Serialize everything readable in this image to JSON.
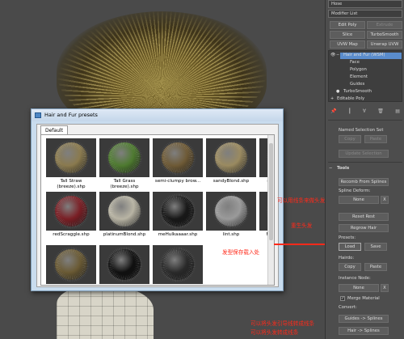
{
  "dialog": {
    "title": "Hair and Fur presets",
    "tab": "Default",
    "presets": [
      {
        "label": "Tall Straw\n(breeze).shp",
        "color": "#8a7a4e"
      },
      {
        "label": "Tall Grass\n(breeze).shp",
        "color": "#4e7a30"
      },
      {
        "label": "semi-clumpy brow...",
        "color": "#6e5a36"
      },
      {
        "label": "sandyBlond.shp",
        "color": "#9a8a60"
      },
      {
        "label": "redStraight.shp",
        "color": "#8a2028"
      },
      {
        "label": "redScraggle.shp",
        "color": "#7a1f25"
      },
      {
        "label": "platinumBlond.shp",
        "color": "#b8b4a4"
      },
      {
        "label": "meHulkaaaar.shp",
        "color": "#181818"
      },
      {
        "label": "lint.shp",
        "color": "#9a9a9a"
      },
      {
        "label": "FuzzyBrown.shp",
        "color": "#5e4424"
      },
      {
        "label": "",
        "color": "#6a5a34"
      },
      {
        "label": "",
        "color": "#101010"
      },
      {
        "label": "",
        "color": "#2a2a2a"
      }
    ]
  },
  "panel": {
    "top_field": "Hose",
    "modifier_list": "Modifier List",
    "buttons": {
      "edit_poly": "Edit Poly",
      "extrude": "Extrude",
      "slice": "Slice",
      "turbosmooth": "TurboSmooth",
      "uvw_map": "UVW Map",
      "unwrap_uvw": "Unwrap UVW"
    },
    "stack": {
      "hair_and_fur": "Hair and Fur (WSM)",
      "face": "Face",
      "polygon": "Polygon",
      "element": "Element",
      "guides": "Guides",
      "turbosmooth": "TurboSmooth",
      "editable_poly": "Editable Poly"
    },
    "named_selection_set": "Named Selection Set",
    "copy1": "Copy",
    "paste1": "Paste",
    "update_selection": "Update Selection",
    "tools_header": "Tools",
    "recomb_from_splines": "Recomb From Splines",
    "spline_deform": "Spline Deform:",
    "none1": "None",
    "x1": "X",
    "reset_rest": "Reset Rest",
    "regrow_hair": "Regrow Hair",
    "presets_label": "Presets:",
    "load": "Load",
    "save": "Save",
    "hairdo_label": "Hairdo:",
    "copy2": "Copy",
    "paste2": "Paste",
    "instance_node": "Instance Node:",
    "none2": "None",
    "x2": "X",
    "merge_material": "Merge Material",
    "convert_label": "Convert:",
    "guides_splines": "Guides -> Splines",
    "hair_splines": "Hair -> Splines"
  },
  "annotations": {
    "splines_note": "可以用线条来做头发",
    "regrow_note": "重生头发",
    "load_note": "发型保存载入处",
    "convert_note1": "可以将头发引导线转成线条",
    "convert_note2": "可以将头发转成线条"
  },
  "colors": {
    "annotation": "#ff2a1a",
    "selection": "#5a8ccc"
  }
}
